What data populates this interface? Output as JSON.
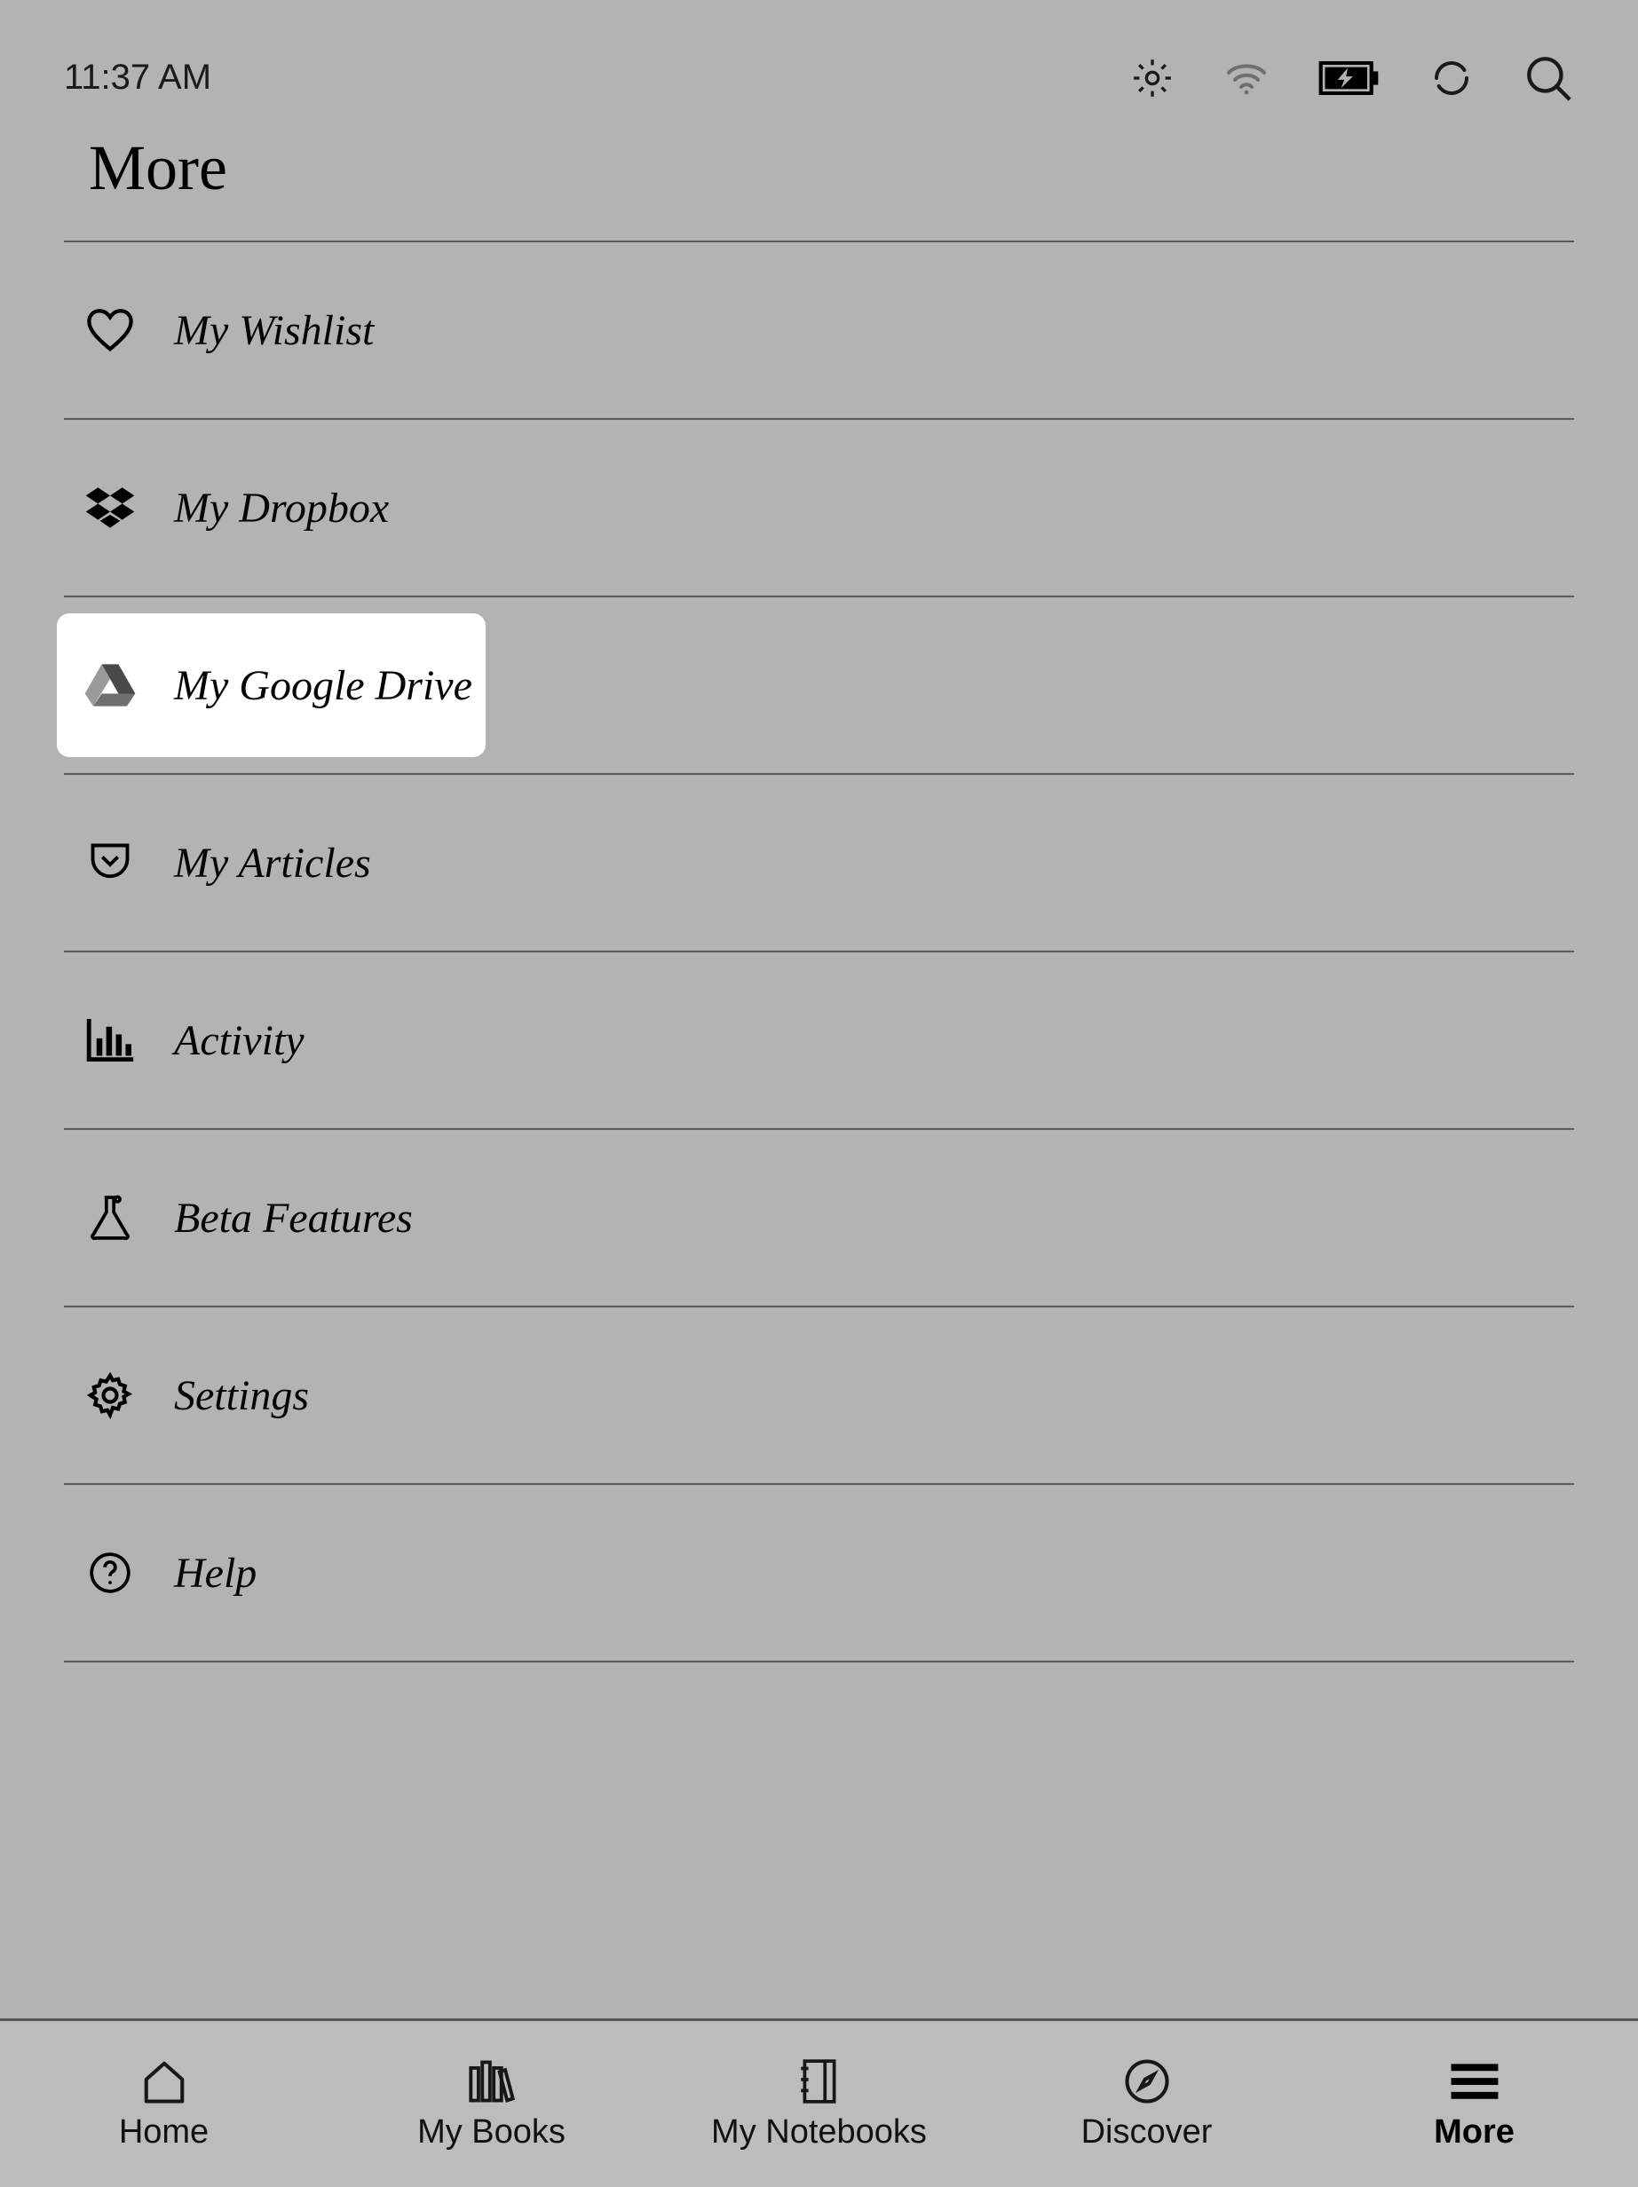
{
  "status": {
    "time": "11:37 AM"
  },
  "page": {
    "title": "More"
  },
  "menu": {
    "items": [
      {
        "label": "My Wishlist"
      },
      {
        "label": "My Dropbox"
      },
      {
        "label": "My Google Drive"
      },
      {
        "label": "My Articles"
      },
      {
        "label": "Activity"
      },
      {
        "label": "Beta Features"
      },
      {
        "label": "Settings"
      },
      {
        "label": "Help"
      }
    ]
  },
  "nav": {
    "items": [
      {
        "label": "Home"
      },
      {
        "label": "My Books"
      },
      {
        "label": "My Notebooks"
      },
      {
        "label": "Discover"
      },
      {
        "label": "More"
      }
    ]
  }
}
